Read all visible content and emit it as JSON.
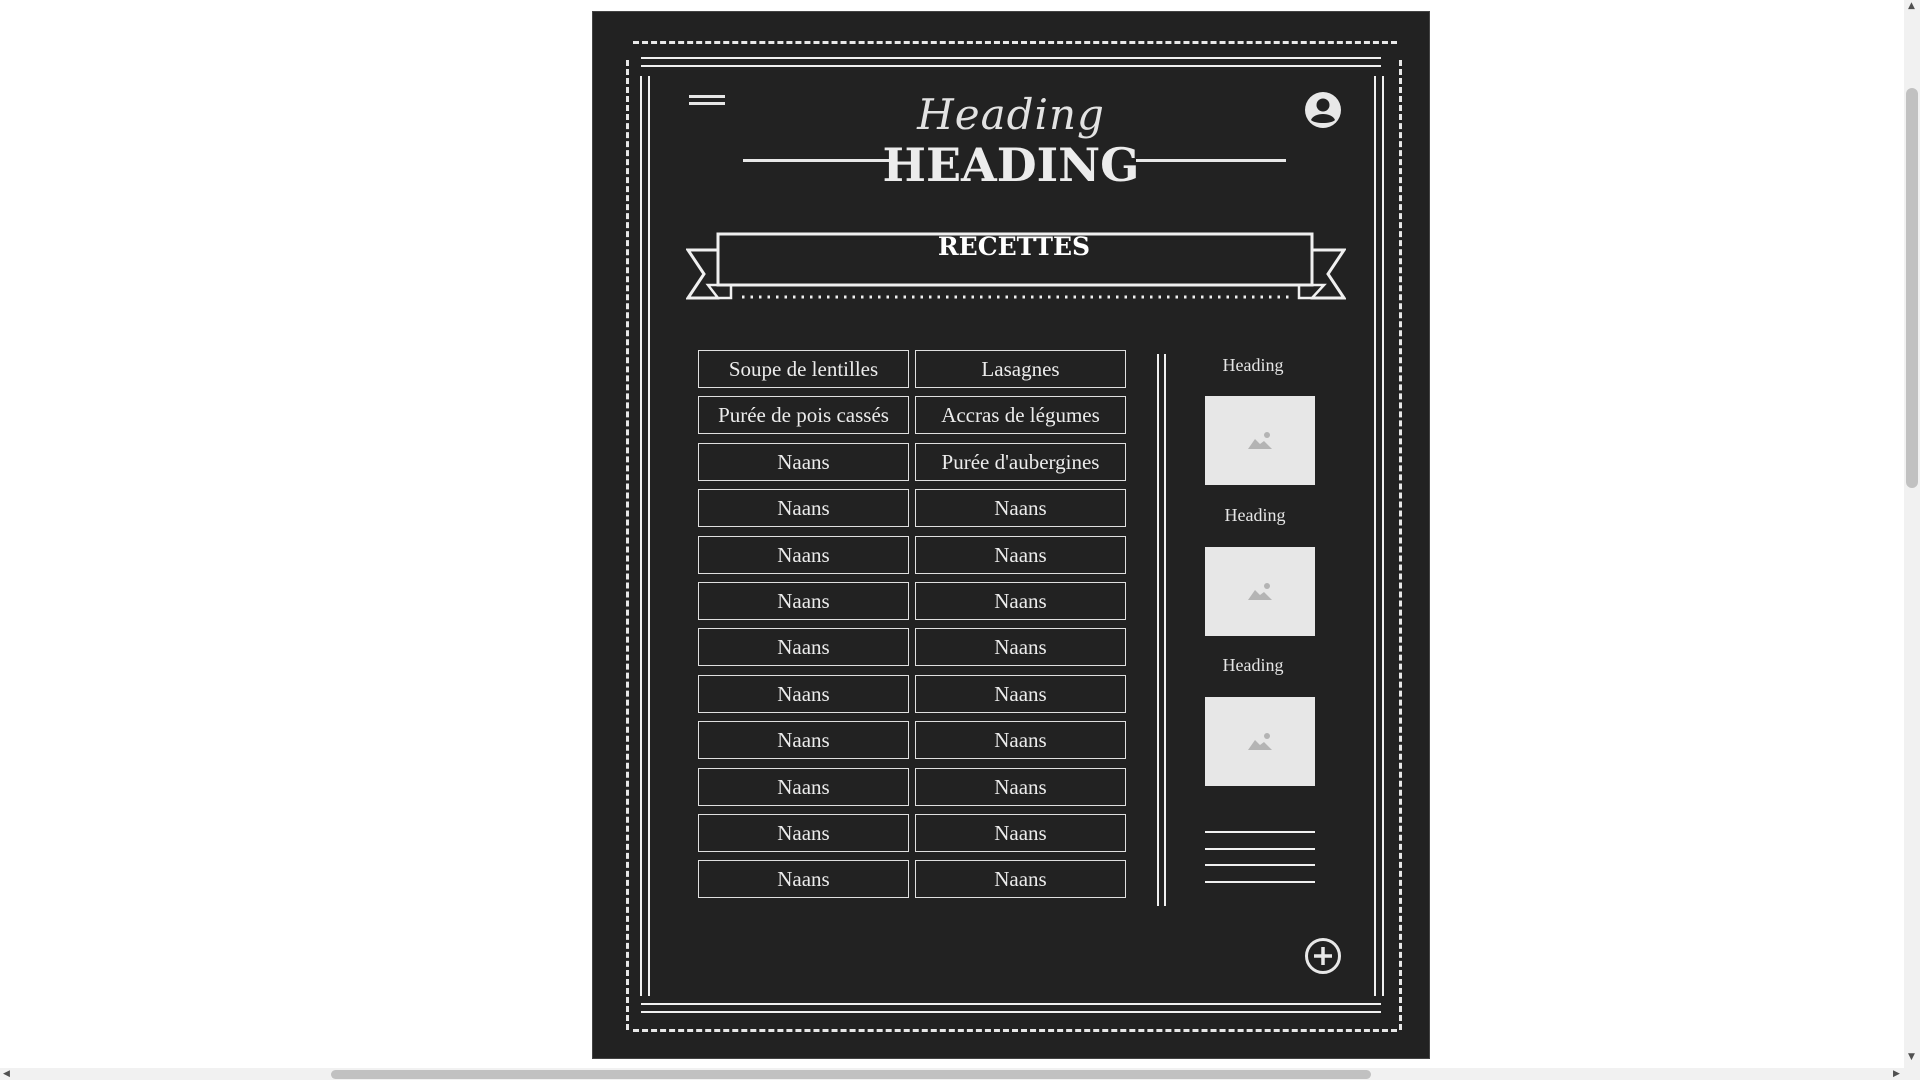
{
  "header": {
    "script_title": "Heading",
    "main_title": "HEADING"
  },
  "banner": {
    "label": "RECETTES"
  },
  "recipes": [
    [
      "Soupe de lentilles",
      "Lasagnes"
    ],
    [
      "Purée de pois cassés",
      "Accras de légumes"
    ],
    [
      "Naans",
      "Purée d'aubergines"
    ],
    [
      "Naans",
      "Naans"
    ],
    [
      "Naans",
      "Naans"
    ],
    [
      "Naans",
      "Naans"
    ],
    [
      "Naans",
      "Naans"
    ],
    [
      "Naans",
      "Naans"
    ],
    [
      "Naans",
      "Naans"
    ],
    [
      "Naans",
      "Naans"
    ],
    [
      "Naans",
      "Naans"
    ],
    [
      "Naans",
      "Naans"
    ]
  ],
  "sidebar": {
    "items": [
      {
        "heading": "Heading",
        "image_icon": "image-placeholder-icon"
      },
      {
        "heading": "Heading",
        "image_icon": "image-placeholder-icon"
      },
      {
        "heading": "Heading",
        "image_icon": "image-placeholder-icon"
      }
    ]
  },
  "icons": {
    "menu": "hamburger-menu-icon",
    "account": "account-circle-icon",
    "add": "add-circle-icon"
  },
  "colors": {
    "card_background": "#222222",
    "foreground": "#ececec",
    "page_background": "#ffffff",
    "placeholder": "#e7e7e7"
  }
}
